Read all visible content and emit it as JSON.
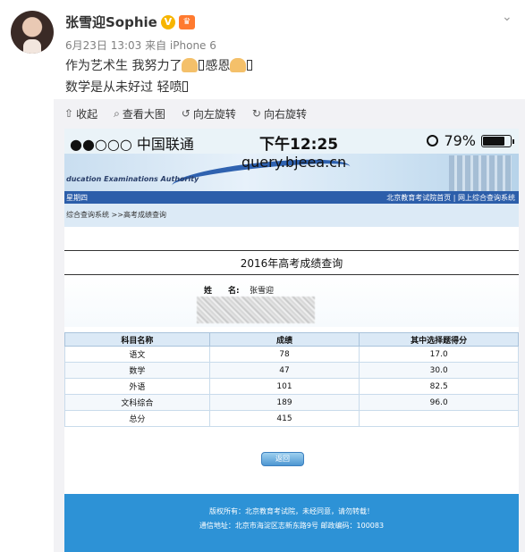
{
  "post": {
    "username": "张雪迎Sophie",
    "meta": "6月23日 13:03 来自 iPhone 6",
    "line1_a": "作为艺术生 我努力了",
    "line1_b": "感恩",
    "line2": "数学是从未好过 轻喷"
  },
  "toolbar": {
    "collapse": "收起",
    "view_large": "查看大图",
    "rotate_left": "向左旋转",
    "rotate_right": "向右旋转"
  },
  "phone": {
    "carrier": "●●○○○ 中国联通",
    "time": "下午12:25",
    "battery": "79%",
    "url": "query.bjeea.cn",
    "authority": "ducation Examinations Authority",
    "nav_left": "星期四",
    "nav_right": "北京教育考试院首页 | 网上综合查询系统",
    "breadcrumb": "综合查询系统 >>高考成绩查询",
    "page_title": "2016年高考成绩查询",
    "name_label": "姓　　名:",
    "name_value": "张雪迎",
    "table": {
      "headers": [
        "科目名称",
        "成绩",
        "其中选择题得分"
      ],
      "rows": [
        [
          "语文",
          "78",
          "17.0"
        ],
        [
          "数学",
          "47",
          "30.0"
        ],
        [
          "外语",
          "101",
          "82.5"
        ],
        [
          "文科综合",
          "189",
          "96.0"
        ],
        [
          "总分",
          "415",
          ""
        ]
      ]
    },
    "back_button": "返回",
    "footer1": "版权所有：北京教育考试院，未经同意，请勿转载！",
    "footer2": "通信地址：北京市海淀区志新东路9号 邮政编码：100083"
  }
}
